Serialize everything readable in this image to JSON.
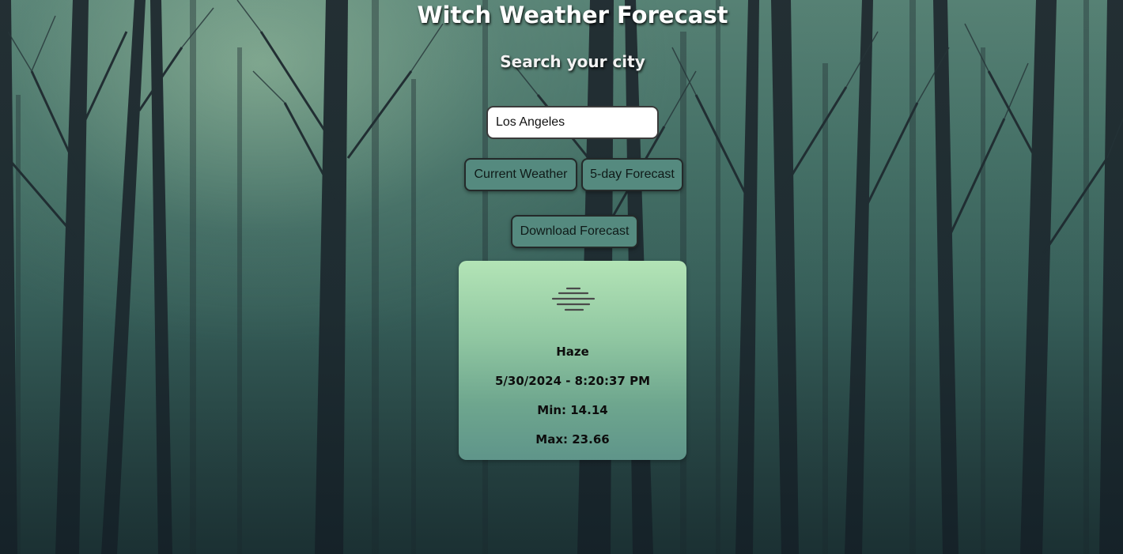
{
  "header": {
    "title": "Witch Weather Forecast",
    "subtitle": "Search your city"
  },
  "search": {
    "value": "Los Angeles",
    "placeholder": ""
  },
  "buttons": {
    "current_weather": "Current Weather",
    "five_day": "5-day Forecast",
    "download": "Download Forecast"
  },
  "weather_card": {
    "icon": "haze-icon",
    "description": "Haze",
    "datetime": "5/30/2024 - 8:20:37 PM",
    "min": "Min: 14.14",
    "max": "Max: 23.66"
  },
  "colors": {
    "button_bg": "#558a7f",
    "card_top": "#b3e4b6",
    "card_bottom": "#5f958a"
  }
}
